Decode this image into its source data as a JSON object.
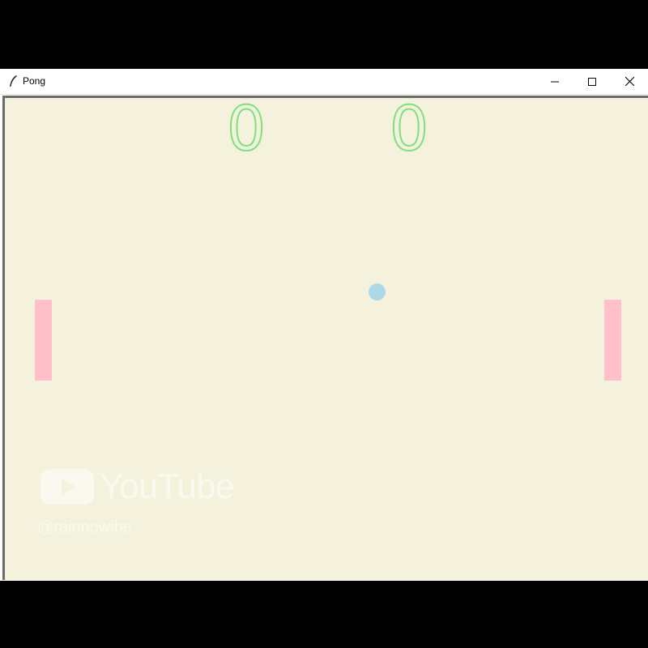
{
  "window": {
    "title": "Pong",
    "controls": {
      "minimize": "minimize-icon",
      "maximize": "maximize-icon",
      "close": "close-icon"
    }
  },
  "game": {
    "scores": {
      "left": "0",
      "right": "0"
    },
    "colors": {
      "background": "#f4f2dc",
      "paddle": "#ffc0cb",
      "ball": "#add8e6",
      "score": "#7ee07e"
    }
  },
  "watermark": {
    "platform": "YouTube",
    "handle": "@rainnowibe"
  }
}
